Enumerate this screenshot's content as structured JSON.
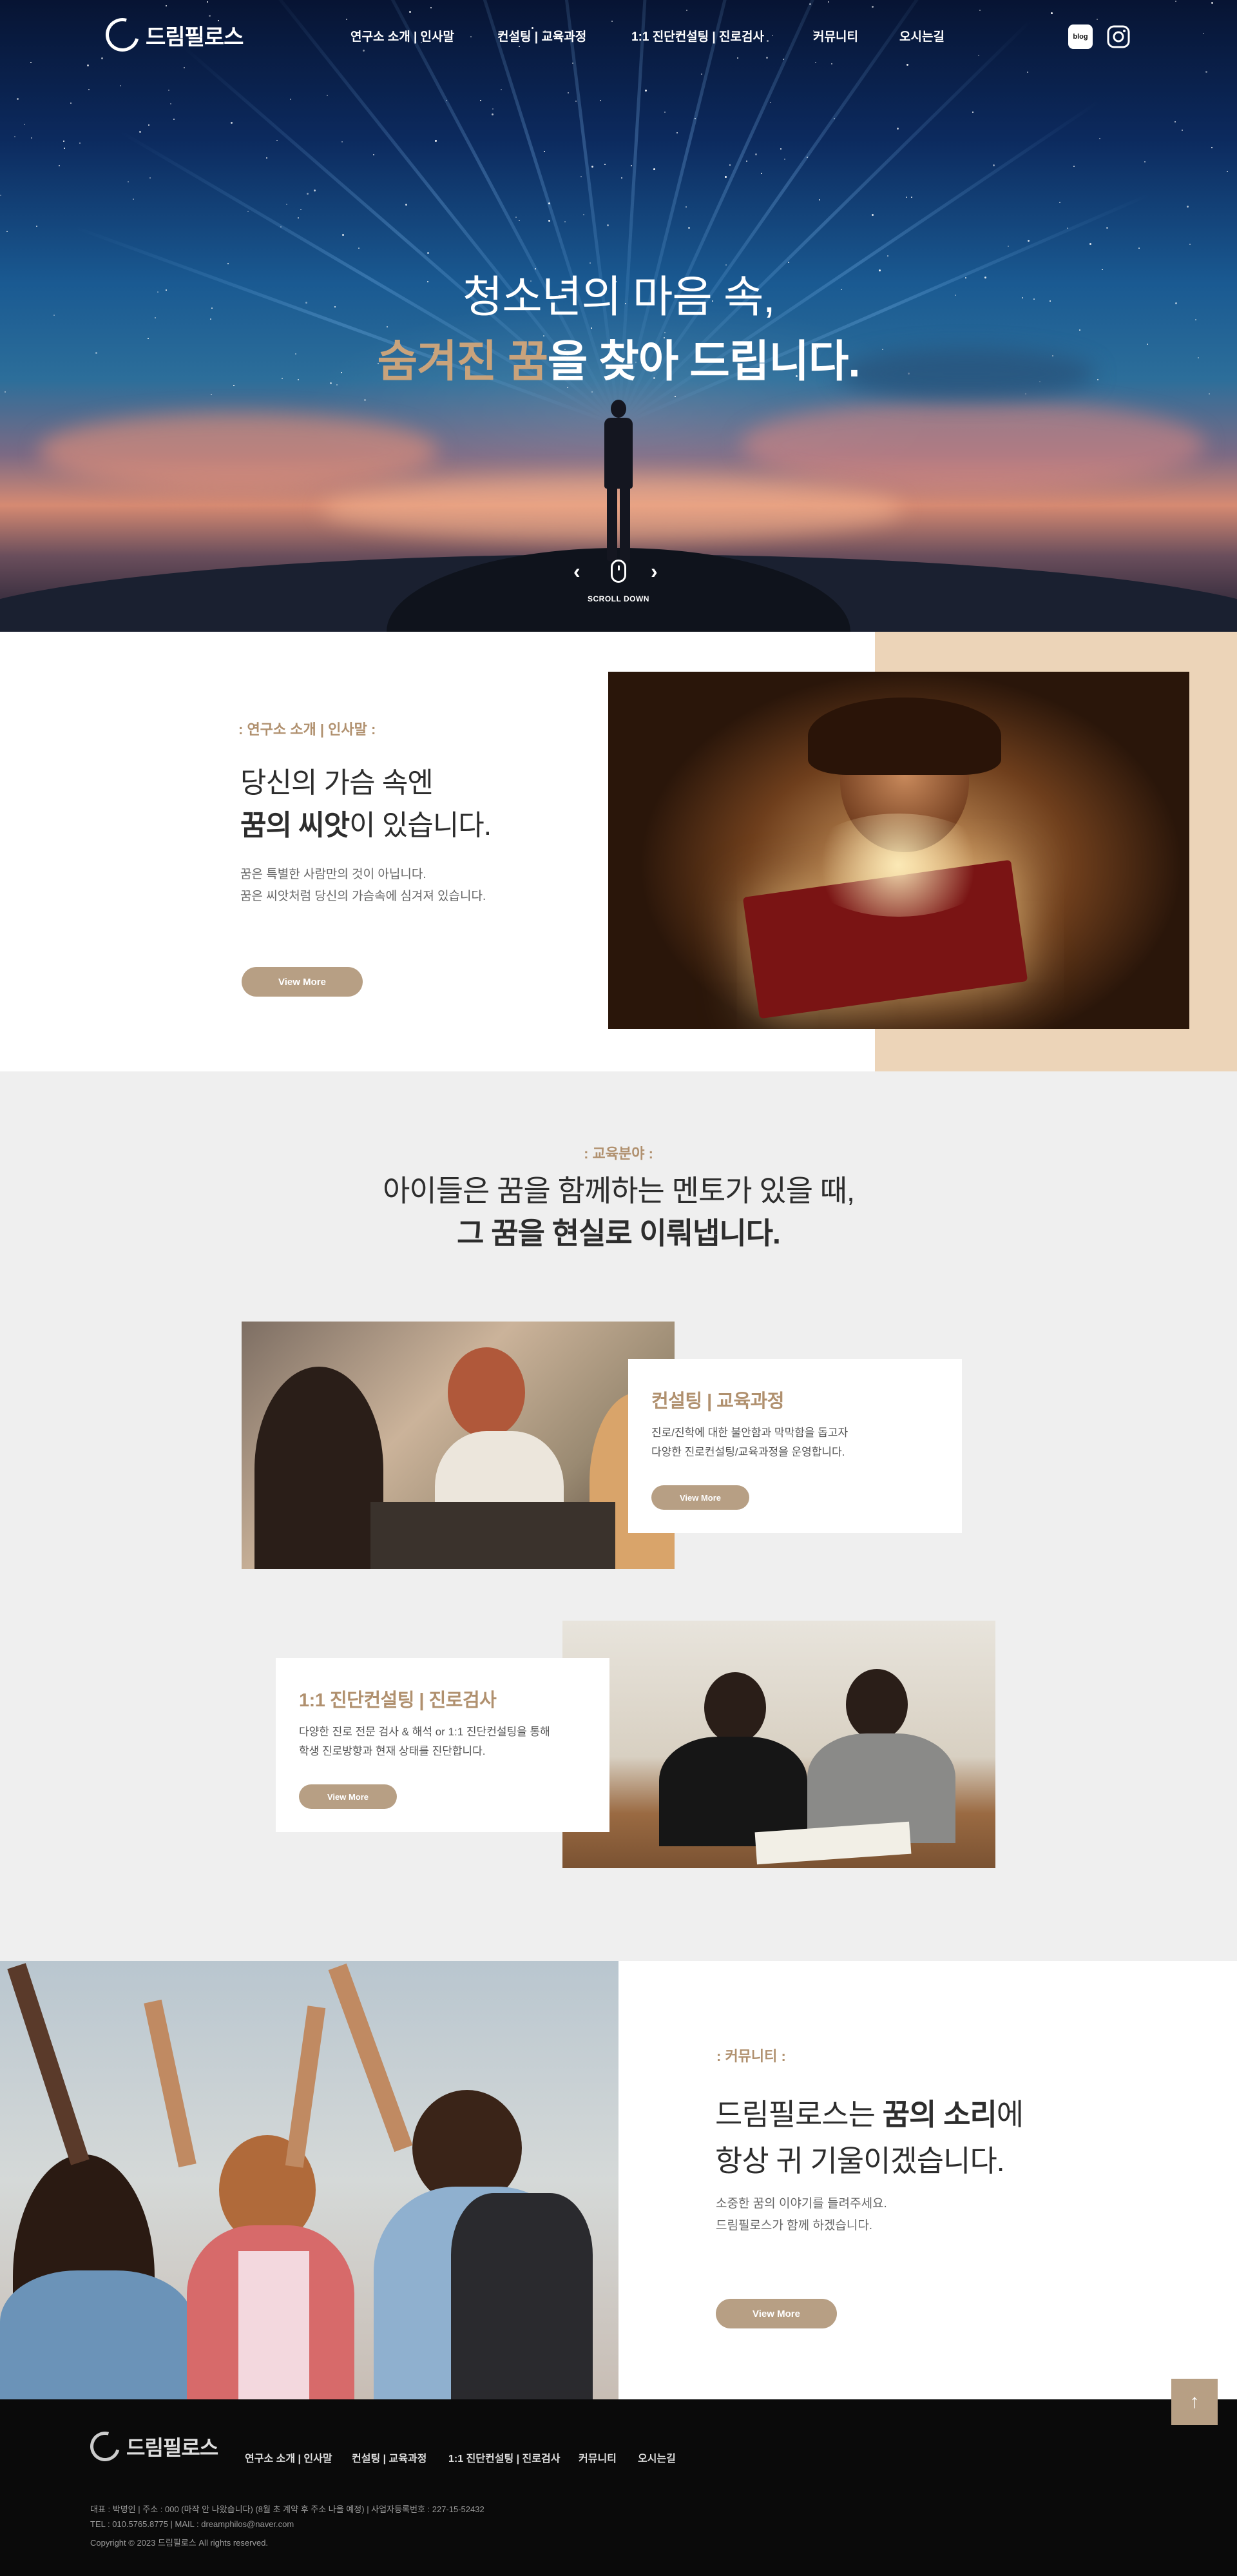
{
  "header": {
    "logo_text": "드림필로스",
    "nav": [
      "연구소 소개 | 인사말",
      "컨설팅 | 교육과정",
      "1:1 진단컨설팅 | 진로검사",
      "커뮤니티",
      "오시는길"
    ],
    "sns": [
      "blog-icon",
      "instagram-icon"
    ],
    "blog_label": "blog"
  },
  "hero": {
    "line1": "청소년의 마음 속,",
    "line2_gold": "숨겨진 꿈",
    "line2_rest1": "을 ",
    "line2_bold": "찾아 드립니다.",
    "scroll_text": "SCROLL DOWN",
    "prev": "‹",
    "next": "›"
  },
  "intro": {
    "tag": ":    연구소 소개  |  인사말    :",
    "heading_line1": "당신의 가슴 속엔",
    "heading_bold": "꿈의 씨앗",
    "heading_line2_rest": "이 있습니다.",
    "desc_line1": "꿈은 특별한 사람만의 것이 아닙니다.",
    "desc_line2": "꿈은 씨앗처럼 당신의 가슴속에 심겨져 있습니다.",
    "button": "View More"
  },
  "education": {
    "tag": ":    교육분야    :",
    "heading_line1": "아이들은 꿈을 함께하는 멘토가 있을 때,",
    "heading_line2": "그 꿈을 현실로 이뤄냅니다.",
    "cards": [
      {
        "title": "컨설팅 | 교육과정",
        "desc_line1": "진로/진학에 대한 불안함과 막막함을 돕고자",
        "desc_line2": "다양한 진로컨설팅/교육과정을 운영합니다.",
        "button": "View More"
      },
      {
        "title": "1:1 진단컨설팅 | 진로검사",
        "desc_line1": "다양한 진로 전문 검사 & 해석 or 1:1 진단컨설팅을 통해",
        "desc_line2": "학생 진로방향과 현재 상태를 진단합니다.",
        "button": "View More"
      }
    ]
  },
  "community": {
    "tag": ":    커뮤니티    :",
    "heading_pre": "드림필로스는 ",
    "heading_bold": "꿈의 소리",
    "heading_post": "에",
    "heading_line2": "항상 귀 기울이겠습니다.",
    "desc_line1": "소중한 꿈의 이야기를 들려주세요.",
    "desc_line2": "드림필로스가 함께 하겠습니다.",
    "button": "View More"
  },
  "footer": {
    "logo_text": "드림필로스",
    "nav": [
      "연구소 소개 | 인사말",
      "컨설팅 | 교육과정",
      "1:1 진단컨설팅 | 진로검사",
      "커뮤니티",
      "오시는길"
    ],
    "info_line1": "대표 : 박명인  |  주소 : 000 (마작 안 나왔습니다) (8월 초 계약 후 주소 나올 예정)  |  사업자등록번호 : 227-15-52432",
    "info_line2": "TEL : 010.5765.8775  |  MAIL : dreamphilos@naver.com",
    "copyright": "Copyright © 2023 드림필로스 All rights reserved.",
    "top_button": "↑"
  },
  "colors": {
    "accent_gold": "#c9a37c",
    "tag_brown": "#b0906e",
    "button_tan": "#b79f84",
    "beige_panel": "#ecd4b8",
    "section_gray": "#efefef",
    "footer_black": "#0a0a0a"
  }
}
